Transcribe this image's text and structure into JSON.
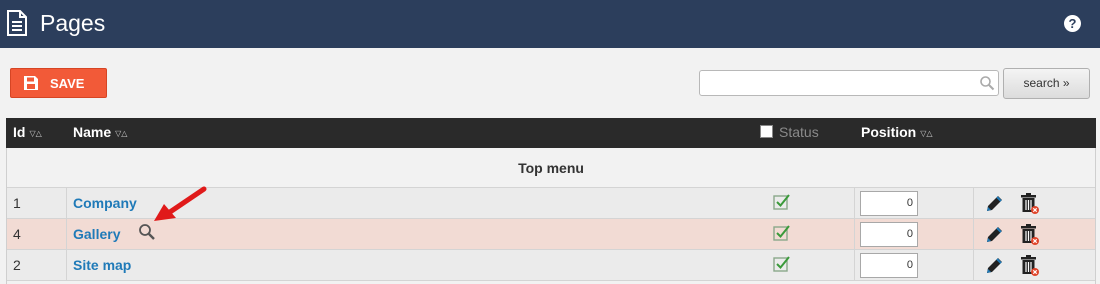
{
  "header": {
    "title": "Pages",
    "help_label": "?"
  },
  "toolbar": {
    "save_label": "SAVE",
    "search_value": "",
    "search_button_label": "search »"
  },
  "table": {
    "columns": {
      "id": "Id",
      "name": "Name",
      "status": "Status",
      "position": "Position"
    },
    "sort_glyph": "▽△",
    "group_label": "Top menu",
    "rows": [
      {
        "id": "1",
        "name": "Company",
        "position": "0"
      },
      {
        "id": "4",
        "name": "Gallery",
        "position": "0"
      },
      {
        "id": "2",
        "name": "Site map",
        "position": "0"
      }
    ]
  },
  "colors": {
    "header_bg": "#2c3e5c",
    "save_bg": "#f25a38",
    "table_head_bg": "#2a2a2a",
    "link": "#1f7ab8",
    "highlight_row": "#f2dbd4",
    "row_bg": "#ebebeb"
  },
  "icons": [
    "document-icon",
    "help-icon",
    "floppy-icon",
    "magnifier-icon",
    "checkbox-icon",
    "status-check-icon",
    "pencil-icon",
    "trash-icon",
    "red-arrow-icon"
  ]
}
